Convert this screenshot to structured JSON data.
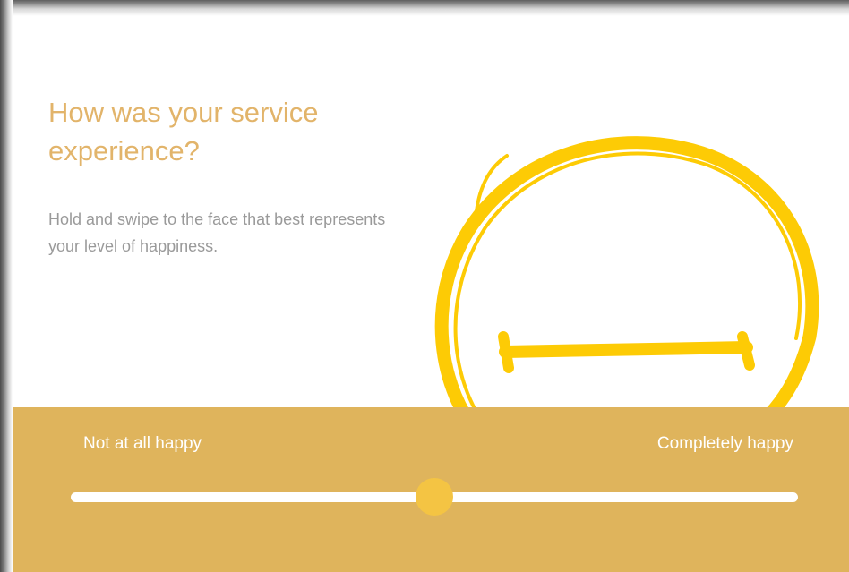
{
  "survey": {
    "title": "How was your service experience?",
    "instructions": "Hold and swipe to the face that best represents your level of happiness."
  },
  "face": {
    "icon": "neutral-face-icon",
    "expression": "neutral",
    "stroke_color": "#fdcb05"
  },
  "rating": {
    "min_label": "Not at all happy",
    "max_label": "Completely happy",
    "value": 0.5
  },
  "colors": {
    "title": "#e2b46a",
    "instructions": "#9a9a9a",
    "panel": "#dfb45c",
    "track": "#ffffff",
    "thumb": "#f4c443"
  }
}
